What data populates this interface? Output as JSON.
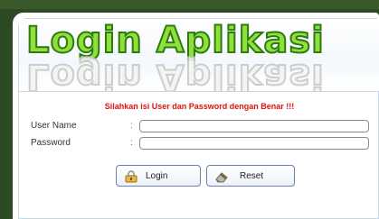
{
  "header": {
    "logo_text": "Login Aplikasi"
  },
  "message": "Silahkan isi User dan Password dengan Benar !!!",
  "form": {
    "username": {
      "label": "User Name",
      "colon": ":",
      "value": ""
    },
    "password": {
      "label": "Password",
      "colon": ":",
      "value": ""
    }
  },
  "buttons": {
    "login": {
      "label": "Login",
      "icon": "login-lock-icon"
    },
    "reset": {
      "label": "Reset",
      "icon": "eraser-icon"
    }
  },
  "colors": {
    "background": "#2e4a22",
    "logo_fill": "#8fe03a",
    "logo_stroke": "#2d7a12",
    "message": "#e01010",
    "button_border": "#6f7fb3"
  }
}
